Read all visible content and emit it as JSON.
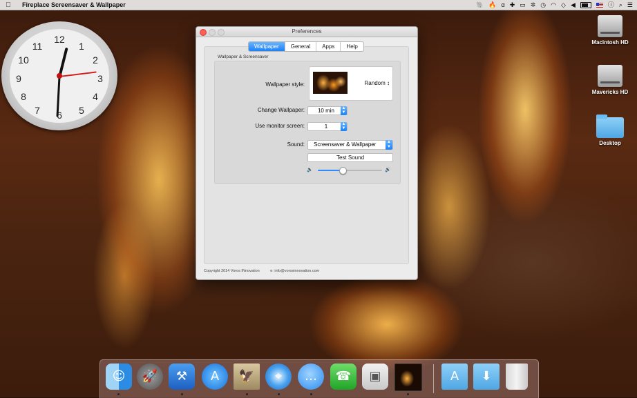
{
  "menubar": {
    "apple_icon": "",
    "app_name": "Fireplace Screensaver & Wallpaper",
    "status_icons": [
      "evernote-icon",
      "flame-icon",
      "cursive-icon",
      "plus-icon",
      "airplay-icon",
      "bluetooth-icon",
      "time-machine-icon",
      "wifi-icon",
      "dropbox-icon",
      "volume-icon",
      "battery-icon",
      "flag-icon",
      "info-icon",
      "search-icon",
      "list-icon"
    ]
  },
  "desktop": {
    "icons": [
      {
        "label": "Macintosh HD",
        "type": "drive"
      },
      {
        "label": "Mavericks HD",
        "type": "drive"
      },
      {
        "label": "Desktop",
        "type": "folder"
      }
    ],
    "clock": {
      "numerals": [
        "12",
        "1",
        "2",
        "3",
        "4",
        "5",
        "6",
        "7",
        "8",
        "9",
        "10",
        "11"
      ]
    }
  },
  "window": {
    "title": "Preferences",
    "tabs": [
      {
        "label": "Wallpaper",
        "active": true
      },
      {
        "label": "General",
        "active": false
      },
      {
        "label": "Apps",
        "active": false
      },
      {
        "label": "Help",
        "active": false
      }
    ],
    "group_title": "Wallpaper & Screensaver",
    "wallpaper_style": {
      "label": "Wallpaper style:",
      "value": "Random ↕"
    },
    "change_wallpaper": {
      "label": "Change Wallpaper:",
      "value": "10 min"
    },
    "monitor_screen": {
      "label": "Use monitor screen:",
      "value": "1"
    },
    "sound": {
      "label": "Sound:",
      "value": "Screensaver & Wallpaper"
    },
    "test_sound_button": "Test Sound",
    "volume": 0.38,
    "footer": {
      "copyright": "Copyright 2014 Voros INnovation",
      "email": "e: info@vorosinnovation.com"
    }
  },
  "dock": {
    "items": [
      "finder-icon",
      "launchpad-icon",
      "xcode-icon",
      "app-store-icon",
      "preview-icon",
      "safari-icon",
      "messages-icon",
      "facetime-icon",
      "photo-browser-icon",
      "fireplace-app-icon",
      "applications-folder-icon",
      "downloads-folder-icon",
      "trash-icon"
    ]
  },
  "colors": {
    "accent": "#1a82fb",
    "close_button": "#fc5f57"
  }
}
